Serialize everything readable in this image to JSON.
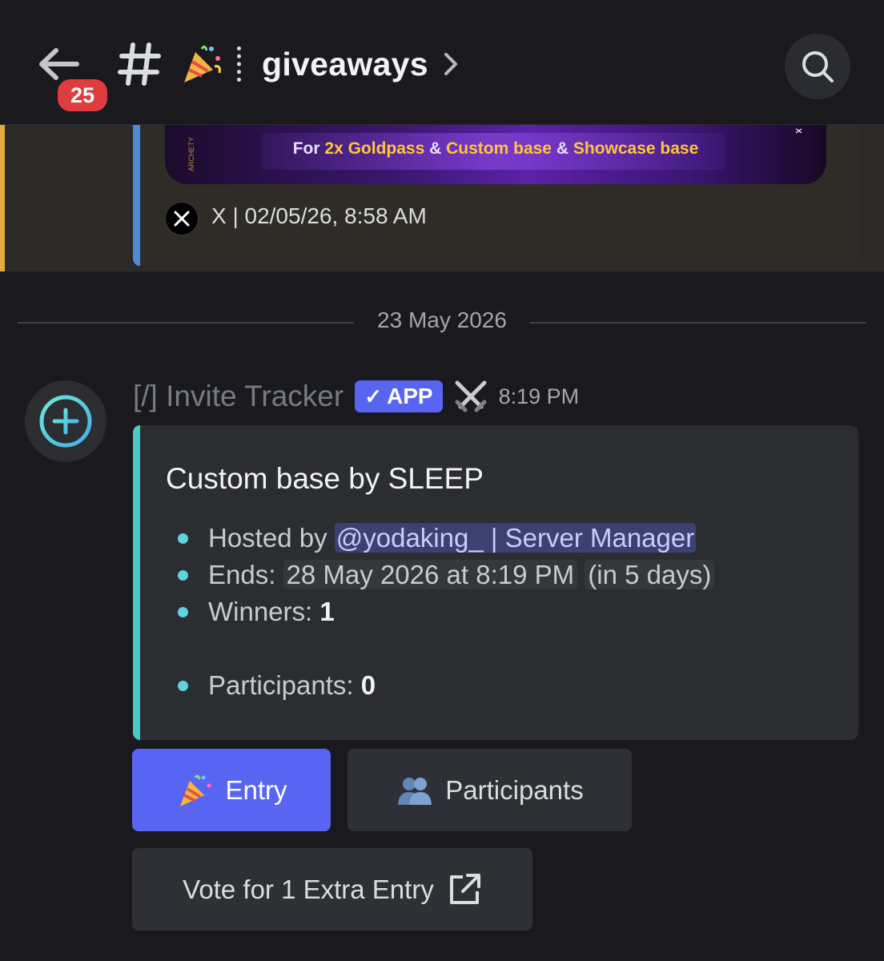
{
  "header": {
    "unread_count": "25",
    "channel_name": "giveaways"
  },
  "previous_embed": {
    "banner": {
      "prefix": "For ",
      "part1": "2x Goldpass",
      "sep1": " & ",
      "part2": "Custom base",
      "sep2": " & ",
      "part3": "Showcase base",
      "side_left": "ARCHETY",
      "side_right": "X"
    },
    "footer": "X | 02/05/26, 8:58 AM"
  },
  "date_divider": "23 May 2026",
  "message": {
    "author": "[/] Invite Tracker",
    "badge": "APP",
    "badge_check": "✓",
    "timestamp": "8:19 PM",
    "embed": {
      "title": "Custom base by SLEEP",
      "hosted_label": "Hosted by ",
      "hosted_mention": "@yodaking_ | Server Manager",
      "ends_label": "Ends: ",
      "ends_date": "28 May 2026 at 8:19 PM",
      "ends_relative": "(in 5 days)",
      "winners_label": "Winners: ",
      "winners_value": "1",
      "participants_label": "Participants: ",
      "participants_value": "0"
    },
    "buttons": {
      "entry": "Entry",
      "participants": "Participants",
      "vote": "Vote for 1 Extra Entry"
    }
  },
  "colors": {
    "accent": "#5865f2",
    "embed_bar": "#4cc9c5",
    "highlight": "#e4a83a",
    "badge_red": "#e03c3f"
  }
}
